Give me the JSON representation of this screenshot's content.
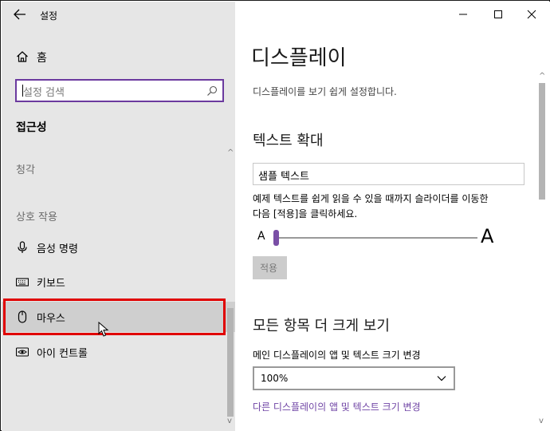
{
  "app": {
    "title": "설정"
  },
  "sidebar": {
    "home_label": "홈",
    "search_placeholder": "설정 검색",
    "section_title": "접근성",
    "groups": [
      "청각",
      "상호 작용"
    ],
    "items": [
      {
        "label": "음성 명령",
        "icon": "microphone-icon"
      },
      {
        "label": "키보드",
        "icon": "keyboard-icon"
      },
      {
        "label": "마우스",
        "icon": "mouse-icon",
        "selected": true
      },
      {
        "label": "아이 컨트롤",
        "icon": "eye-control-icon"
      }
    ]
  },
  "main": {
    "title": "디스플레이",
    "description": "디스플레이를 보기 쉽게 설정합니다.",
    "text_size": {
      "heading": "텍스트 확대",
      "sample_text": "샘플 텍스트",
      "instruction_line1": "예제 텍스트를 쉽게 읽을 수 있을 때까지 슬라이더를 이동한",
      "instruction_line2": "다음 [적용]을 클릭하세요.",
      "small_marker": "A",
      "large_marker": "A",
      "slider_level_percent": 0,
      "apply_label": "적용"
    },
    "everything_bigger": {
      "heading": "모든 항목 더 크게 보기",
      "dropdown_label": "메인 디스플레이의 앱 및 텍스트 크기 변경",
      "dropdown_value": "100%",
      "link_text": "다른 디스플레이의 앱 및 텍스트 크기 변경"
    }
  },
  "colors": {
    "accent": "#7045a5",
    "sidebar_bg": "#e6e6e6",
    "highlight_border": "#e00000"
  }
}
